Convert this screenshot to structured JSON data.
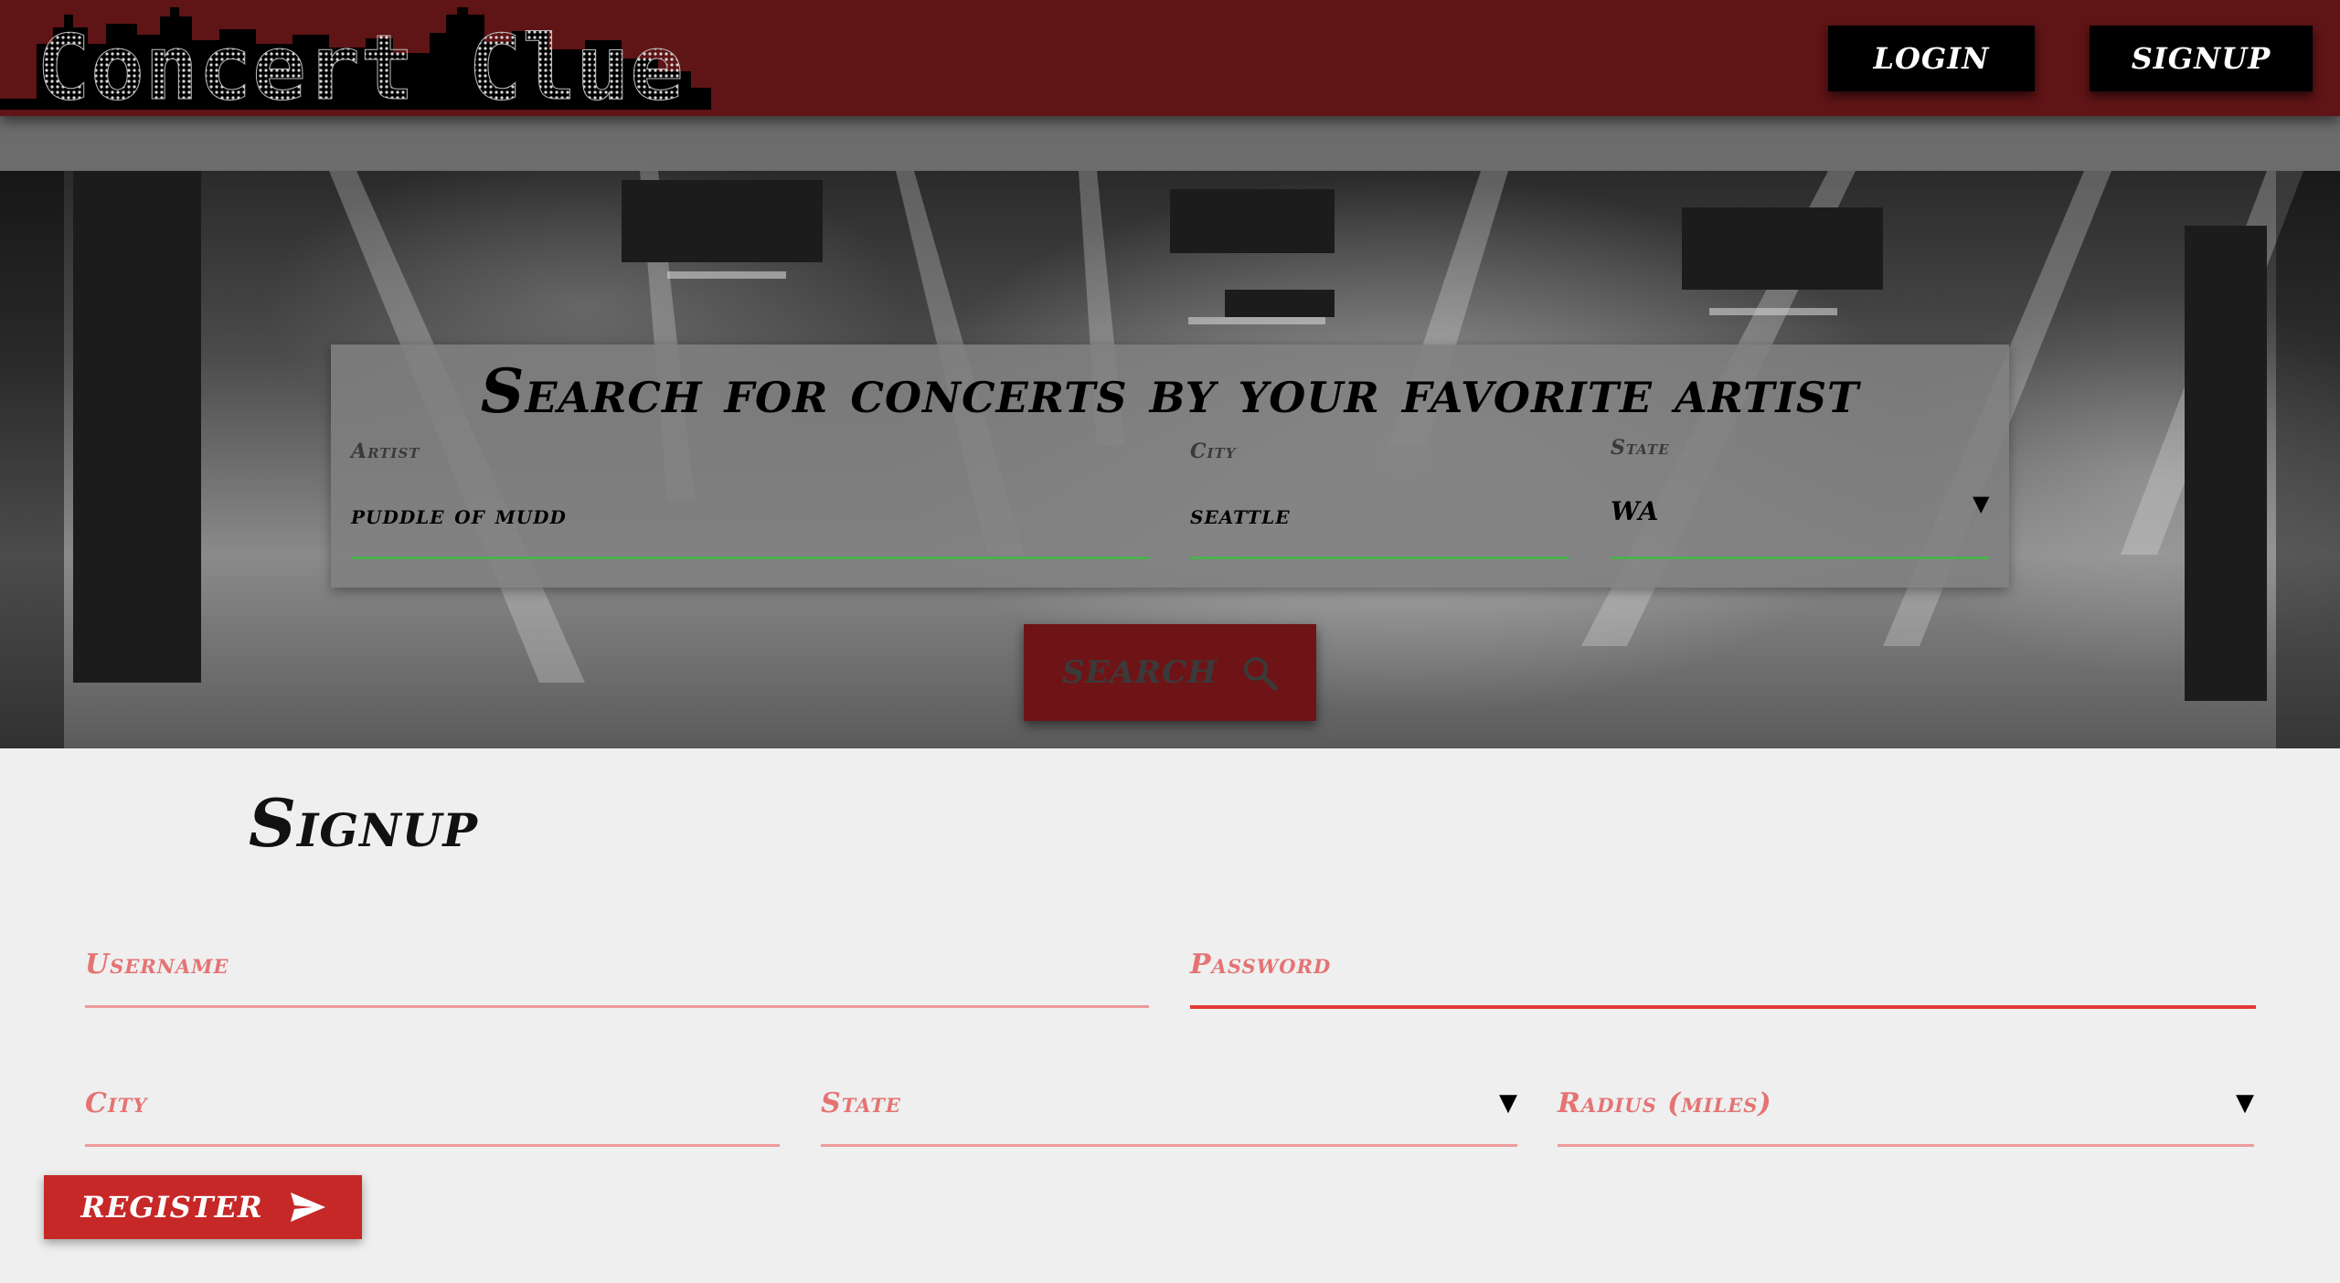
{
  "app": {
    "logo_text": "Concert Clue",
    "brand_color": "#5f1416",
    "accent_color": "#c62828"
  },
  "nav": {
    "login_label": "LOGIN",
    "signup_label": "SIGNUP"
  },
  "search": {
    "title": "Search for concerts by your favorite artist",
    "artist_label": "Artist",
    "artist_value": "puddle of mudd",
    "city_label": "City",
    "city_value": "seattle",
    "state_label": "State",
    "state_value": "WA",
    "button_label": "SEARCH",
    "button_icon": "search-icon"
  },
  "signup": {
    "heading": "Signup",
    "username_label": "Username",
    "password_label": "Password",
    "city_label": "City",
    "state_label": "State",
    "radius_label": "Radius (miles)",
    "register_label": "REGISTER",
    "register_icon": "send-icon"
  }
}
